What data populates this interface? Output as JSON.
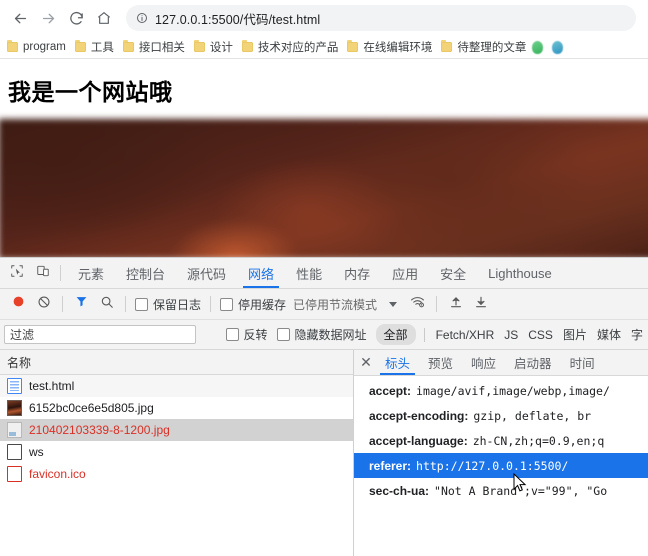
{
  "browser": {
    "nav": {
      "back": "back-arrow",
      "forward": "forward-arrow",
      "reload": "reload",
      "home": "home"
    },
    "omnibox": {
      "url": "127.0.0.1:5500/代码/test.html",
      "info_icon": "info-circle"
    },
    "bookmarks": [
      {
        "label": "program"
      },
      {
        "label": "工具"
      },
      {
        "label": "接口相关"
      },
      {
        "label": "设计"
      },
      {
        "label": "技术对应的产品"
      },
      {
        "label": "在线编辑环境"
      },
      {
        "label": "待整理的文章"
      }
    ],
    "extensions": [
      {
        "name": "extension-green"
      },
      {
        "name": "extension-teal"
      }
    ]
  },
  "page": {
    "heading": "我是一个网站哦",
    "hero_image_alt": "blurred dark red photo"
  },
  "devtools": {
    "tabs": [
      {
        "label": "元素",
        "active": false
      },
      {
        "label": "控制台",
        "active": false
      },
      {
        "label": "源代码",
        "active": false
      },
      {
        "label": "网络",
        "active": true
      },
      {
        "label": "性能",
        "active": false
      },
      {
        "label": "内存",
        "active": false
      },
      {
        "label": "应用",
        "active": false
      },
      {
        "label": "安全",
        "active": false
      },
      {
        "label": "Lighthouse",
        "active": false
      }
    ],
    "toolbar": {
      "record_icon": "record-circle",
      "clear_icon": "clear-circle-slash",
      "filter_icon": "funnel-filter",
      "search_icon": "search-magnifier",
      "preserve_log": "保留日志",
      "disable_cache": "停用缓存",
      "throttling": "已停用节流模式",
      "network_conditions_icon": "wifi-gear",
      "import_icon": "upload-arrow",
      "export_icon": "download-arrow"
    },
    "filterbar": {
      "filter_placeholder": "过滤",
      "invert": "反转",
      "hide_data_urls": "隐藏数据网址",
      "types": [
        {
          "label": "全部",
          "active": true
        },
        {
          "label": "Fetch/XHR",
          "active": false
        },
        {
          "label": "JS",
          "active": false
        },
        {
          "label": "CSS",
          "active": false
        },
        {
          "label": "图片",
          "active": false
        },
        {
          "label": "媒体",
          "active": false
        },
        {
          "label": "字",
          "active": false
        }
      ]
    },
    "requests": {
      "column_header": "名称",
      "rows": [
        {
          "name": "test.html",
          "icon": "document-icon",
          "state": "normal"
        },
        {
          "name": "6152bc0ce6e5d805.jpg",
          "icon": "image-thumb-icon",
          "state": "normal"
        },
        {
          "name": "210402103339-8-1200.jpg",
          "icon": "image-blank-icon",
          "state": "error-selected"
        },
        {
          "name": "ws",
          "icon": "generic-icon",
          "state": "normal"
        },
        {
          "name": "favicon.ico",
          "icon": "generic-red-icon",
          "state": "error"
        }
      ]
    },
    "details": {
      "close_icon": "close-icon",
      "tabs": [
        {
          "label": "标头",
          "active": true
        },
        {
          "label": "预览",
          "active": false
        },
        {
          "label": "响应",
          "active": false
        },
        {
          "label": "启动器",
          "active": false
        },
        {
          "label": "时间",
          "active": false
        }
      ],
      "headers": [
        {
          "key": "accept:",
          "value": "image/avif,image/webp,image/",
          "selected": false
        },
        {
          "key": "accept-encoding:",
          "value": "gzip, deflate, br",
          "selected": false
        },
        {
          "key": "accept-language:",
          "value": "zh-CN,zh;q=0.9,en;q",
          "selected": false
        },
        {
          "key": "referer:",
          "value": "http://127.0.0.1:5500/",
          "selected": true
        },
        {
          "key": "sec-ch-ua:",
          "value": "\"Not A Brand\";v=\"99\", \"Go",
          "selected": false
        }
      ]
    }
  },
  "colors": {
    "accent": "#1a73e8",
    "error": "#d93025",
    "chrome_bg": "#f3f3f3",
    "bookmark_folder": "#f2d377"
  }
}
